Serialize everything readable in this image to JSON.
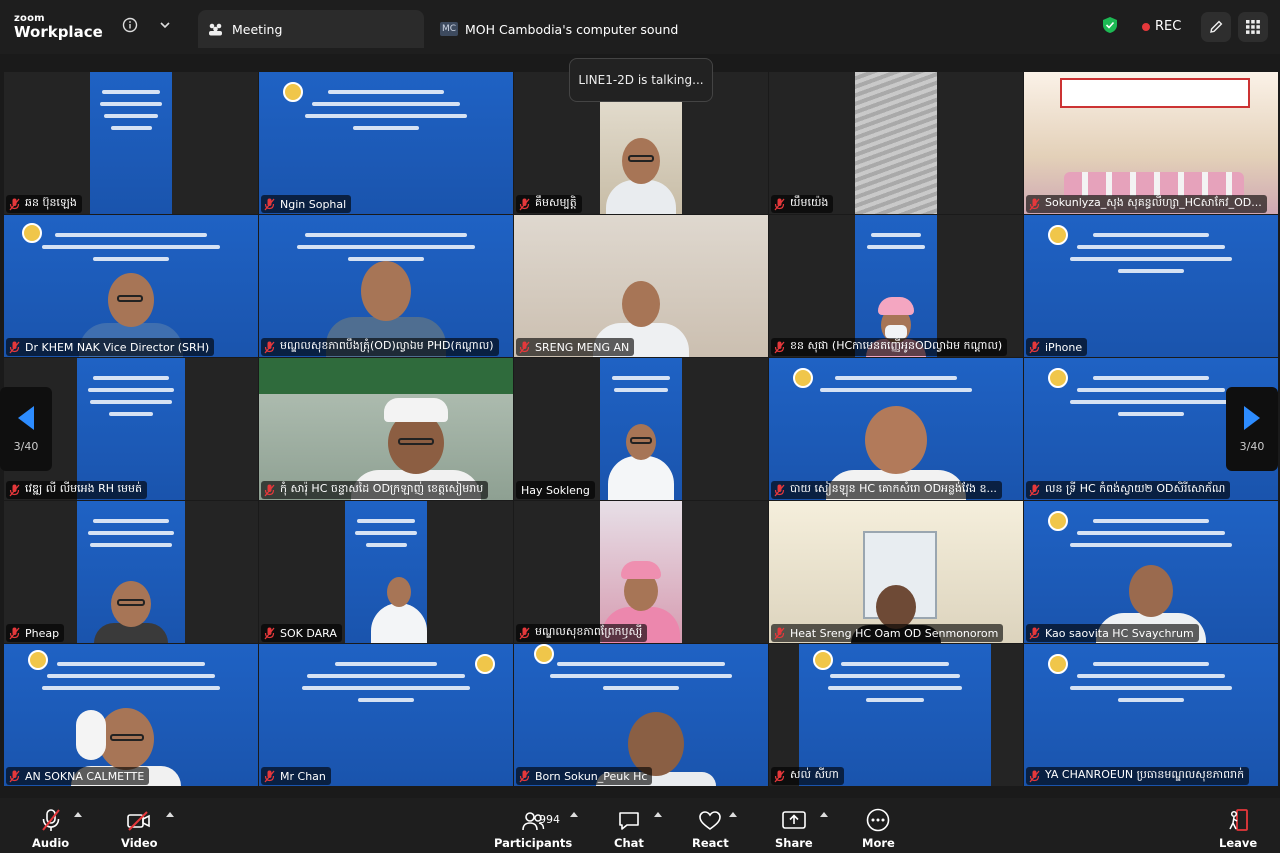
{
  "app": {
    "logo_line1": "zoom",
    "logo_line2": "Workplace"
  },
  "tabs": [
    {
      "label": "Meeting",
      "active": true,
      "icon": "meeting-icon"
    },
    {
      "label": "MOH Cambodia's computer sound",
      "badge": "MC",
      "active": false
    }
  ],
  "status": {
    "rec_label": "REC",
    "shield_color": "#1db954",
    "rec_color": "#e5383b"
  },
  "toast": "LINE1-2D is talking...",
  "pager": {
    "left": "3/40",
    "right": "3/40",
    "arrow_color": "#2d8cff"
  },
  "participants": [
    {
      "name": "ឆន ប៊ុនឡេង"
    },
    {
      "name": "Ngin Sophal"
    },
    {
      "name": "គឹមសម្បត្តិ"
    },
    {
      "name": "យឹមយ៉េង"
    },
    {
      "name": "Sokunlyza_សុង សុគន្ធលីហ្សា_HCសាកែវ_OD..."
    },
    {
      "name": "Dr KHEM NAK Vice Director (SRH)"
    },
    {
      "name": "មណ្ឌលសុខភាពបឹងត្រុំ(OD)ល្វាឯម PHD(កណ្តាល)"
    },
    {
      "name": "SRENG MENG AN"
    },
    {
      "name": "ខន សុផា (HCកាមេនតញ្ញើអូនODល្វាឯម កណ្តាល)"
    },
    {
      "name": "iPhone"
    },
    {
      "name": "វេឌ្ឍ លី លីមអេង RH មេមត់"
    },
    {
      "name": "កុំ សារ៉ុ HC ចន្ទាសដៃ ODក្រឡាញ់ ខេត្តសៀមរាប"
    },
    {
      "name": "Hay Sokleng"
    },
    {
      "name": "បាយ សៀនឡុន HC គោកសំរោ ODអន្លង់វែង ឧ..."
    },
    {
      "name": "លន ទ្រី HC កំពង់ស្វាយ២ ODសិរីសោភ័ណ"
    },
    {
      "name": "Pheap"
    },
    {
      "name": "SOK DARA"
    },
    {
      "name": "មណ្ឌលសុខភាពព្រែកឫស្សី"
    },
    {
      "name": "Heat Sreng HC Oam OD Senmonorom"
    },
    {
      "name": "Kao saovita HC Svaychrum"
    },
    {
      "name": "AN SOKNA CALMETTE"
    },
    {
      "name": "Mr Chan"
    },
    {
      "name": "Born Sokun_Peuk Hc"
    },
    {
      "name": "សល់ សីហា"
    },
    {
      "name": "YA CHANROEUN ប្រធានមណ្ឌលសុខភាពរាក់"
    }
  ],
  "toolbar": {
    "audio": "Audio",
    "video": "Video",
    "participants": "Participants",
    "participants_count": "994",
    "chat": "Chat",
    "react": "React",
    "share": "Share",
    "more": "More",
    "leave": "Leave"
  }
}
